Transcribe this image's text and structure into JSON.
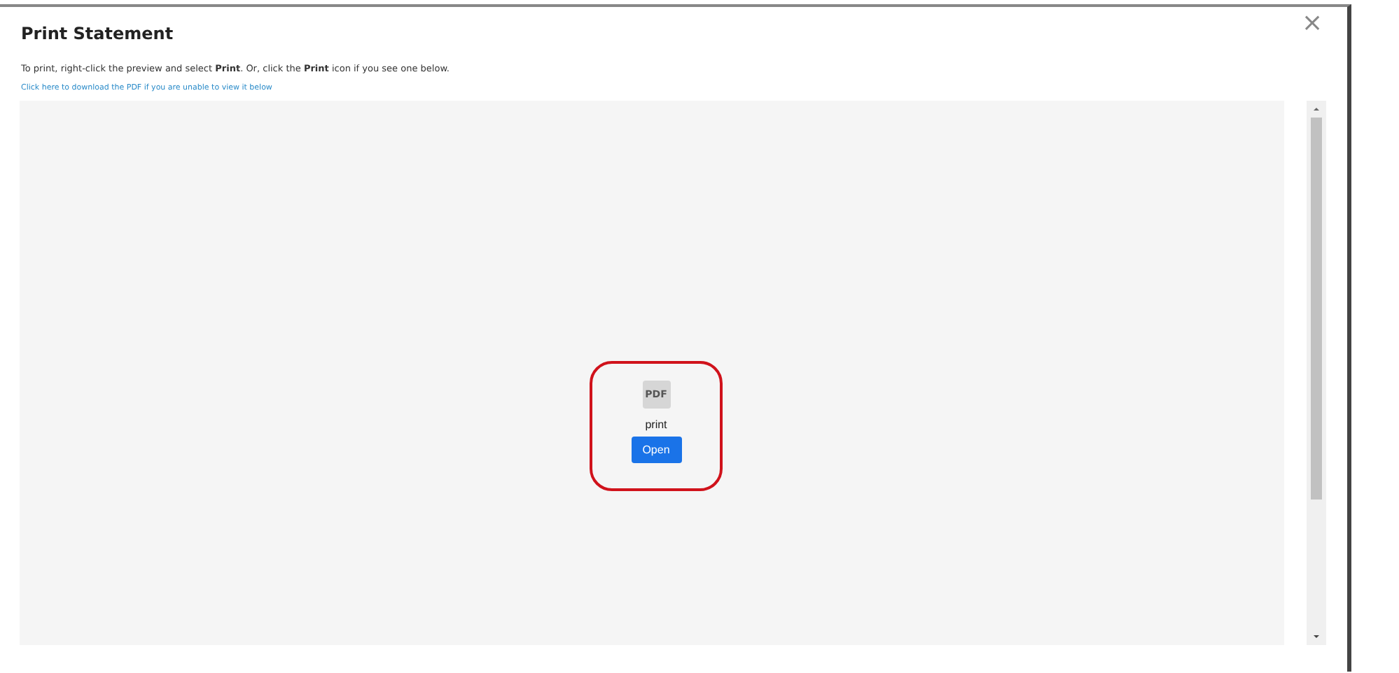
{
  "dialog": {
    "title": "Print Statement",
    "close": "×",
    "instructions": "To print, right-click the preview and select **Print**. Or, click the **Print** icon if you see one below.",
    "download_link": "Click here to download the PDF if you are unable to view it below"
  },
  "preview": {
    "file_icon": "PDF",
    "file_name": "print",
    "open_button": "Open",
    "highlighted": true
  }
}
